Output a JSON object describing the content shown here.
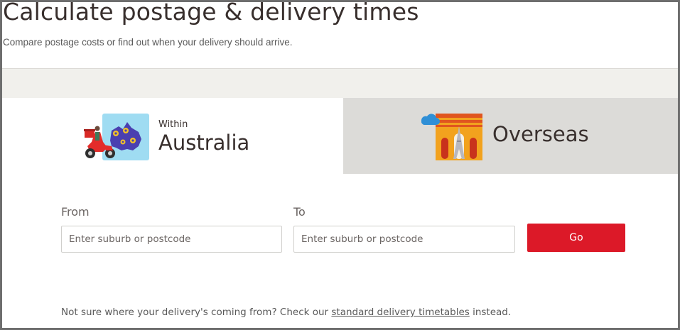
{
  "header": {
    "title": "Calculate postage & delivery times",
    "subtitle": "Compare postage costs or find out when your delivery should arrive."
  },
  "tabs": {
    "within": {
      "prefix": "Within",
      "label": "Australia",
      "icon": "scooter-map-icon"
    },
    "overseas": {
      "label": "Overseas",
      "icon": "arc-eiffel-icon"
    }
  },
  "form": {
    "from_label": "From",
    "from_placeholder": "Enter suburb or postcode",
    "to_label": "To",
    "to_placeholder": "Enter suburb or postcode",
    "go_label": "Go"
  },
  "note": {
    "before": "Not sure where your delivery's coming from? Check our ",
    "link": "standard delivery timetables",
    "after": " instead."
  },
  "colors": {
    "accent": "#dc1928",
    "band": "#f1f0ec",
    "inactive_tab": "#dcdbd8",
    "text": "#382f2d"
  }
}
